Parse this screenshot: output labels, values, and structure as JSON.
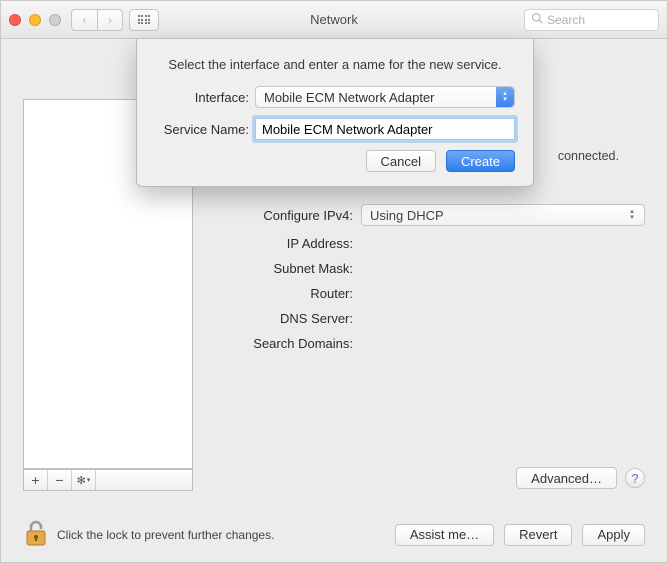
{
  "window": {
    "title": "Network",
    "search_placeholder": "Search"
  },
  "status": {
    "connected": "connected."
  },
  "fields": {
    "configure_ipv4": {
      "label": "Configure IPv4:",
      "value": "Using DHCP"
    },
    "ip_address": {
      "label": "IP Address:"
    },
    "subnet_mask": {
      "label": "Subnet Mask:"
    },
    "router": {
      "label": "Router:"
    },
    "dns_server": {
      "label": "DNS Server:"
    },
    "search_domains": {
      "label": "Search Domains:"
    }
  },
  "buttons": {
    "advanced": "Advanced…",
    "assist": "Assist me…",
    "revert": "Revert",
    "apply": "Apply",
    "cancel": "Cancel",
    "create": "Create"
  },
  "lock": {
    "text": "Click the lock to prevent further changes."
  },
  "sheet": {
    "title": "Select the interface and enter a name for the new service.",
    "interface_label": "Interface:",
    "interface_value": "Mobile ECM Network Adapter",
    "servicename_label": "Service Name:",
    "servicename_value": "Mobile ECM Network Adapter"
  }
}
